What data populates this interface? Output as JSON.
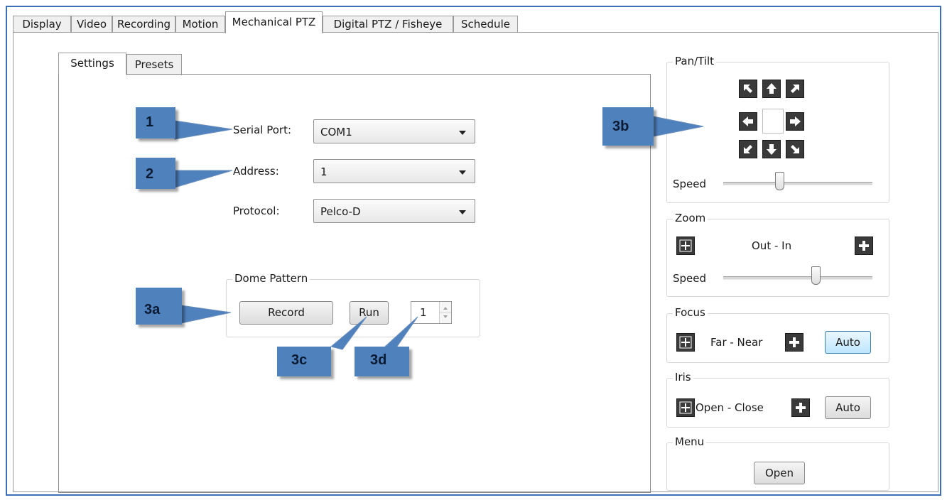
{
  "top_tabs": [
    "Display",
    "Video",
    "Recording",
    "Motion",
    "Mechanical PTZ",
    "Digital PTZ / Fisheye",
    "Schedule"
  ],
  "active_top_tab": "Mechanical PTZ",
  "inner_tabs": [
    "Settings",
    "Presets"
  ],
  "active_inner_tab": "Settings",
  "settings": {
    "serial_port_label": "Serial Port:",
    "serial_port_value": "COM1",
    "address_label": "Address:",
    "address_value": "1",
    "protocol_label": "Protocol:",
    "protocol_value": "Pelco-D"
  },
  "dome_pattern": {
    "title": "Dome Pattern",
    "record_label": "Record",
    "run_label": "Run",
    "pattern_number": "1"
  },
  "ptz_panel": {
    "pan_tilt_title": "Pan/Tilt",
    "pan_tilt_speed_label": "Speed",
    "pan_tilt_speed_level": 0.37,
    "zoom_title": "Zoom",
    "zoom_label": "Out - In",
    "zoom_speed_label": "Speed",
    "zoom_speed_level": 0.63,
    "focus_title": "Focus",
    "focus_label": "Far - Near",
    "focus_auto_label": "Auto",
    "iris_title": "Iris",
    "iris_label": "Open - Close",
    "iris_auto_label": "Auto",
    "menu_title": "Menu",
    "menu_open_label": "Open"
  },
  "callouts": [
    "1",
    "2",
    "3a",
    "3b",
    "3c",
    "3d"
  ],
  "colors": {
    "callout_fill": "#4f81bd",
    "frame_border": "#3a6fb5",
    "focused_button": "#bee6fd"
  },
  "icons": [
    "arrow-up-left-icon",
    "arrow-up-icon",
    "arrow-up-right-icon",
    "arrow-left-icon",
    "arrow-right-icon",
    "arrow-down-left-icon",
    "arrow-down-icon",
    "arrow-down-right-icon",
    "minus-icon",
    "plus-icon"
  ]
}
